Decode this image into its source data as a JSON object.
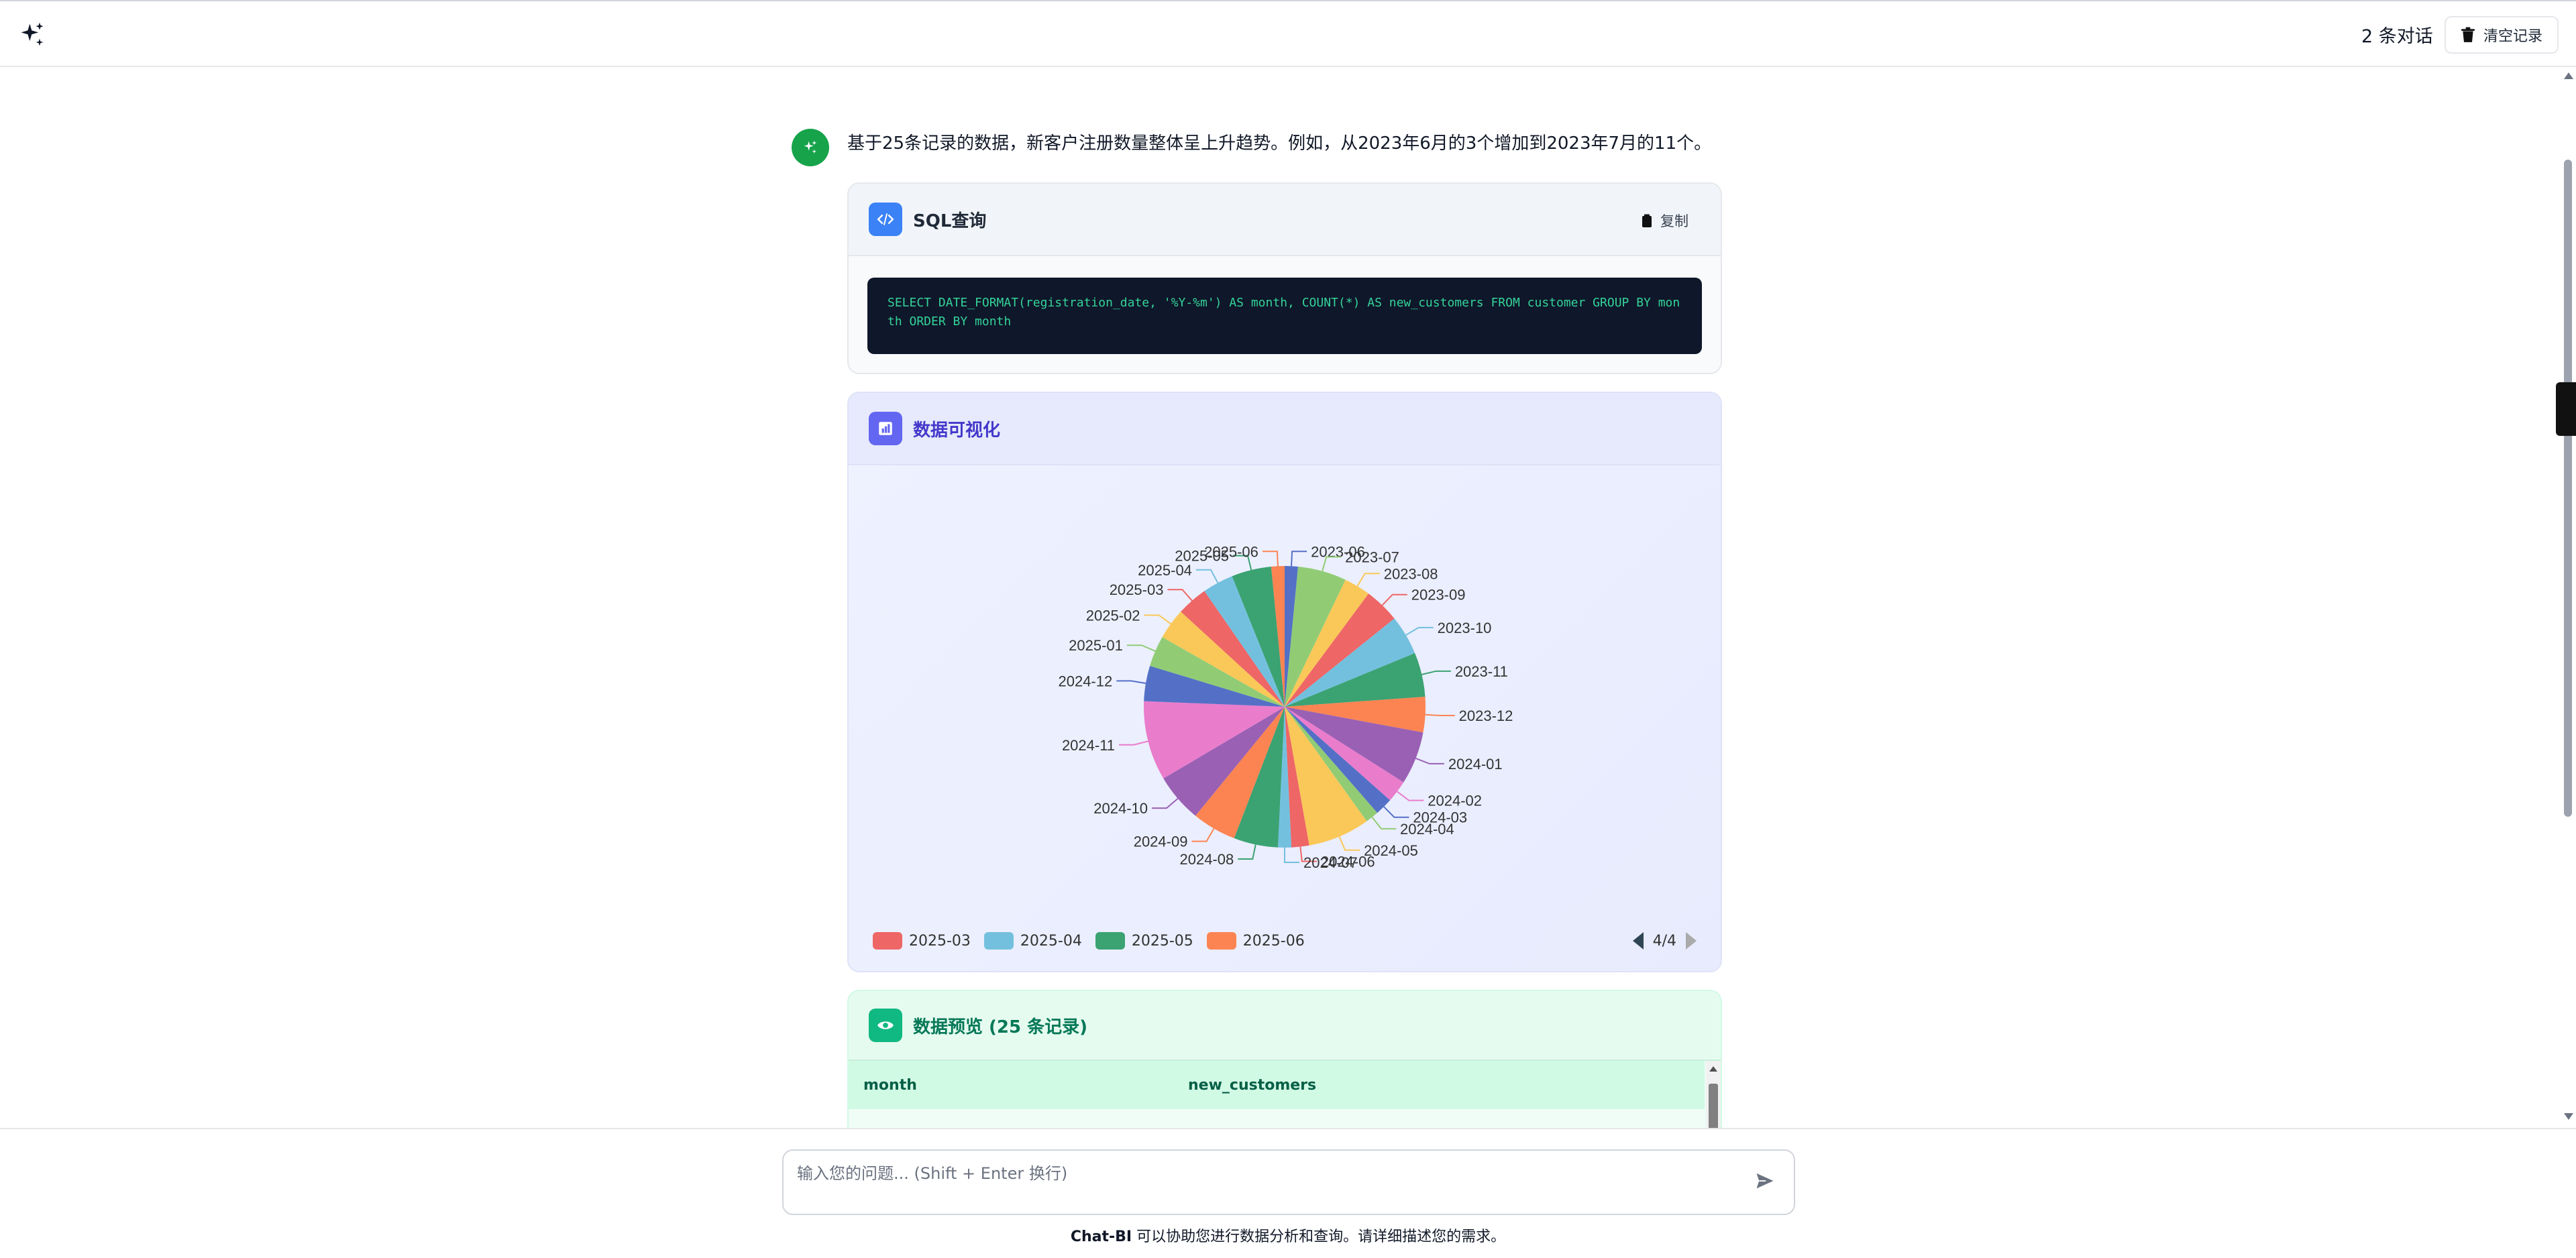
{
  "header": {
    "conversation_count": "2 条对话",
    "clear_label": "清空记录"
  },
  "message": {
    "text": "基于25条记录的数据，新客户注册数量整体呈上升趋势。例如，从2023年6月的3个增加到2023年7月的11个。"
  },
  "sql_card": {
    "title": "SQL查询",
    "copy_label": "复制",
    "code": "SELECT DATE_FORMAT(registration_date, '%Y-%m') AS month, COUNT(*) AS new_customers FROM customer GROUP BY month ORDER BY month"
  },
  "viz_card": {
    "title": "数据可视化",
    "legend_visible": [
      {
        "label": "2025-03",
        "color": "#ee6666"
      },
      {
        "label": "2025-04",
        "color": "#73c0de"
      },
      {
        "label": "2025-05",
        "color": "#3ba272"
      },
      {
        "label": "2025-06",
        "color": "#fc8452"
      }
    ],
    "legend_page": "4/4"
  },
  "chart_data": {
    "type": "pie",
    "title": "",
    "categories": [
      "2023-06",
      "2023-07",
      "2023-08",
      "2023-09",
      "2023-10",
      "2023-11",
      "2023-12",
      "2024-01",
      "2024-02",
      "2024-03",
      "2024-04",
      "2024-05",
      "2024-06",
      "2024-07",
      "2024-08",
      "2024-09",
      "2024-10",
      "2024-11",
      "2024-12",
      "2025-01",
      "2025-02",
      "2025-03",
      "2025-04",
      "2025-05",
      "2025-06"
    ],
    "values": [
      3,
      11,
      6,
      8,
      9,
      10,
      8,
      12,
      5,
      4,
      3,
      14,
      4,
      3,
      10,
      10,
      11,
      18,
      8,
      7,
      7,
      7,
      7,
      9,
      3
    ],
    "colors": [
      "#5470c6",
      "#91cc75",
      "#fac858",
      "#ee6666",
      "#73c0de",
      "#3ba272",
      "#fc8452",
      "#9a60b4",
      "#ea7ccc",
      "#5470c6",
      "#91cc75",
      "#fac858",
      "#ee6666",
      "#73c0de",
      "#3ba272",
      "#fc8452",
      "#9a60b4",
      "#ea7ccc",
      "#5470c6",
      "#91cc75",
      "#fac858",
      "#ee6666",
      "#73c0de",
      "#3ba272",
      "#fc8452"
    ],
    "legend_position": "bottom"
  },
  "data_card": {
    "title": "数据预览 (25 条记录)",
    "columns": [
      "month",
      "new_customers"
    ]
  },
  "input": {
    "placeholder": "输入您的问题... (Shift + Enter 换行)"
  },
  "footer": {
    "brand": "Chat-BI",
    "text": " 可以协助您进行数据分析和查询。请详细描述您的需求。"
  },
  "icons": {
    "logo": "sparkles-icon",
    "trash": "trash-icon",
    "code": "code-icon",
    "clipboard": "clipboard-icon",
    "chart": "chart-icon",
    "eye": "eye-icon",
    "send": "send-icon"
  }
}
